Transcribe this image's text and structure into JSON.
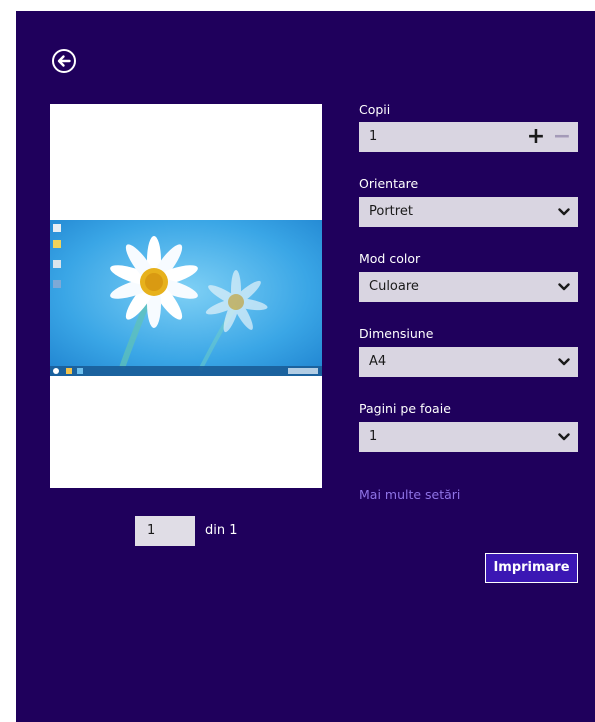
{
  "pager": {
    "current_page": "1",
    "of_text": "din 1"
  },
  "settings": {
    "copies": {
      "label": "Copii",
      "value": "1",
      "plus": "+",
      "minus": "−"
    },
    "orientation": {
      "label": "Orientare",
      "value": "Portret"
    },
    "color_mode": {
      "label": "Mod color",
      "value": "Culoare"
    },
    "size": {
      "label": "Dimensiune",
      "value": "A4"
    },
    "pages_per_sheet": {
      "label": "Pagini pe foaie",
      "value": "1"
    }
  },
  "more_settings_link": "Mai multe setări",
  "print_button": "Imprimare",
  "icons": {
    "back": "back-arrow-circle-icon",
    "dropdown": "chevron-down-icon"
  },
  "colors": {
    "background": "#1f005c",
    "accent": "#3b17b4",
    "link": "#8f73e6",
    "field": "#d9d5e1"
  }
}
